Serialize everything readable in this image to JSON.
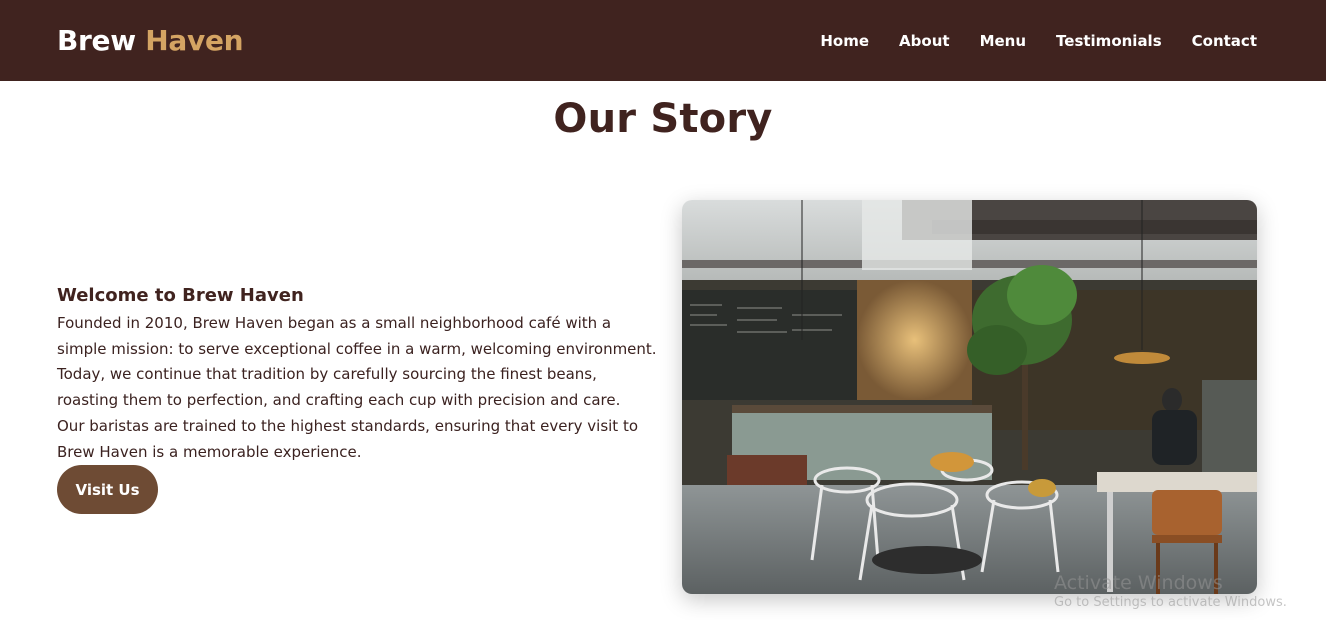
{
  "brand": {
    "name_part1": "Brew",
    "name_part2": "Haven",
    "accent_color": "#d4a463",
    "nav_bg": "#40231f"
  },
  "nav": {
    "items": [
      {
        "label": "Home"
      },
      {
        "label": "About"
      },
      {
        "label": "Menu"
      },
      {
        "label": "Testimonials"
      },
      {
        "label": "Contact"
      }
    ]
  },
  "section": {
    "title": "Our Story"
  },
  "story": {
    "heading": "Welcome to Brew Haven",
    "paragraphs": [
      "Founded in 2010, Brew Haven began as a small neighborhood café with a simple mission: to serve exceptional coffee in a warm, welcoming environment.",
      "Today, we continue that tradition by carefully sourcing the finest beans, roasting them to perfection, and crafting each cup with precision and care.",
      "Our baristas are trained to the highest standards, ensuring that every visit to Brew Haven is a memorable experience."
    ],
    "button_label": "Visit Us",
    "button_color": "#6e4b34"
  },
  "watermark": {
    "line1": "Activate Windows",
    "line2": "Go to Settings to activate Windows."
  }
}
